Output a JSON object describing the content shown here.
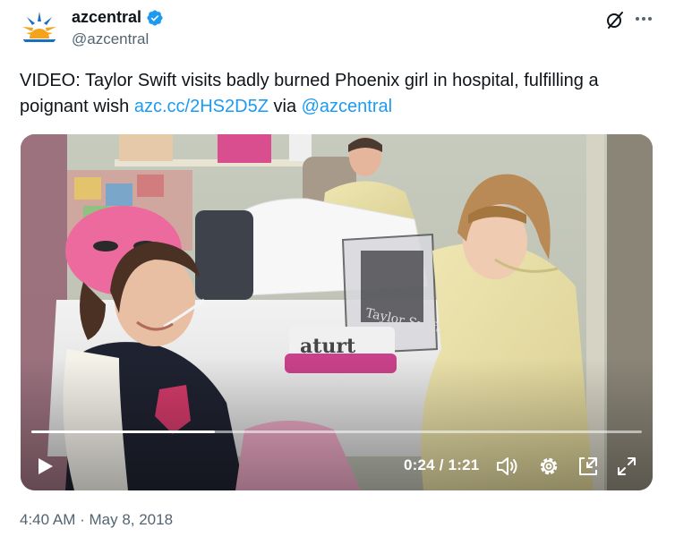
{
  "author": {
    "display_name": "azcentral",
    "handle": "@azcentral",
    "verified_icon": "verified-badge-icon"
  },
  "tweet": {
    "text_main": "VIDEO: Taylor Swift visits badly burned Phoenix girl in hospital, fulfilling a poignant wish ",
    "link": "azc.cc/2HS2D5Z",
    "text_via": " via ",
    "mention": "@azcentral"
  },
  "video": {
    "current_time": "0:24",
    "separator": " / ",
    "duration": "1:21",
    "progress_fraction": 0.3,
    "controls": [
      "play-icon",
      "volume-icon",
      "settings-gear-icon",
      "dock-icon",
      "fullscreen-icon"
    ],
    "bag_text": "Taylor Swift",
    "pillow_text": "aturt"
  },
  "meta": {
    "time": "4:40 AM",
    "dot": " · ",
    "date": "May 8, 2018"
  },
  "colors": {
    "link": "#1d9bf0",
    "secondary_text": "#536471",
    "verified": "#1d9bf0",
    "avatar_sun": "#f6a21a",
    "avatar_sky": "#1a6fc2"
  }
}
